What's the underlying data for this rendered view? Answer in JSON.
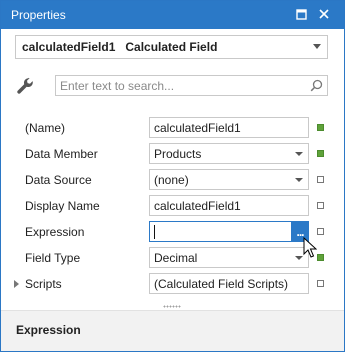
{
  "window": {
    "title": "Properties",
    "buttons": {
      "pin_icon": "pin-icon",
      "close_icon": "close-icon"
    }
  },
  "object_selector": {
    "name": "calculatedField1",
    "type": "Calculated Field",
    "display": "calculatedField1   Calculated Field"
  },
  "search": {
    "placeholder": "Enter text to search...",
    "value": ""
  },
  "properties": [
    {
      "label": "(Name)",
      "value": "calculatedField1",
      "editor": "text",
      "marker": "green"
    },
    {
      "label": "Data Member",
      "value": "Products",
      "editor": "dropdown",
      "marker": "green"
    },
    {
      "label": "Data Source",
      "value": "(none)",
      "editor": "dropdown",
      "marker": "empty"
    },
    {
      "label": "Display Name",
      "value": "calculatedField1",
      "editor": "text",
      "marker": "empty"
    },
    {
      "label": "Expression",
      "value": "",
      "editor": "ellipsis",
      "ellipsis_label": "...",
      "marker": "empty",
      "active": true
    },
    {
      "label": "Field Type",
      "value": "Decimal",
      "editor": "dropdown",
      "marker": "green"
    },
    {
      "label": "Scripts",
      "value": "(Calculated Field Scripts)",
      "editor": "text",
      "marker": "empty",
      "expandable": true
    }
  ],
  "description": {
    "title": "Expression"
  },
  "colors": {
    "accent": "#2b79c7",
    "marker_green": "#5fa23a"
  }
}
